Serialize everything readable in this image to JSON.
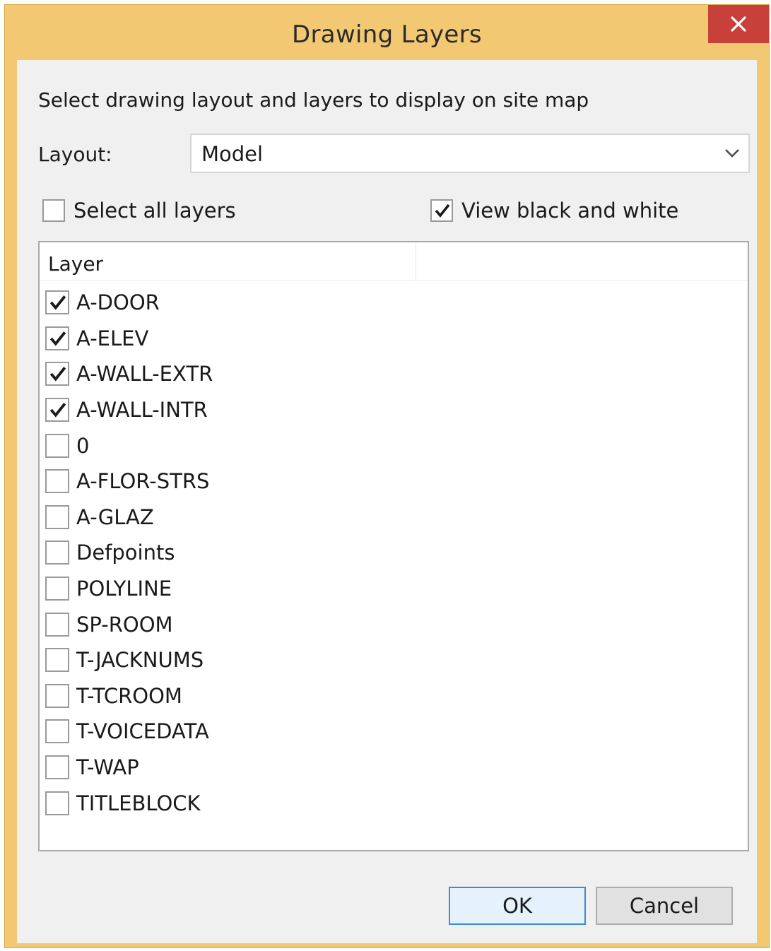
{
  "window": {
    "title": "Drawing Layers",
    "close_label": "×",
    "accent_color": "#f2c972",
    "close_color": "#c7403a"
  },
  "dialog": {
    "instruction": "Select drawing layout and layers to display on site map",
    "layout_label": "Layout:",
    "layout_value": "Model",
    "select_all_label": "Select all layers",
    "select_all_checked": false,
    "black_white_label": "View black and white",
    "black_white_checked": true
  },
  "layers": {
    "column_header": "Layer",
    "items": [
      {
        "name": "A-DOOR",
        "checked": true
      },
      {
        "name": "A-ELEV",
        "checked": true
      },
      {
        "name": "A-WALL-EXTR",
        "checked": true
      },
      {
        "name": "A-WALL-INTR",
        "checked": true
      },
      {
        "name": "0",
        "checked": false
      },
      {
        "name": "A-FLOR-STRS",
        "checked": false
      },
      {
        "name": "A-GLAZ",
        "checked": false
      },
      {
        "name": "Defpoints",
        "checked": false
      },
      {
        "name": "POLYLINE",
        "checked": false
      },
      {
        "name": "SP-ROOM",
        "checked": false
      },
      {
        "name": "T-JACKNUMS",
        "checked": false
      },
      {
        "name": "T-TCROOM",
        "checked": false
      },
      {
        "name": "T-VOICEDATA",
        "checked": false
      },
      {
        "name": "T-WAP",
        "checked": false
      },
      {
        "name": "TITLEBLOCK",
        "checked": false
      }
    ]
  },
  "buttons": {
    "ok_label": "OK",
    "cancel_label": "Cancel"
  }
}
